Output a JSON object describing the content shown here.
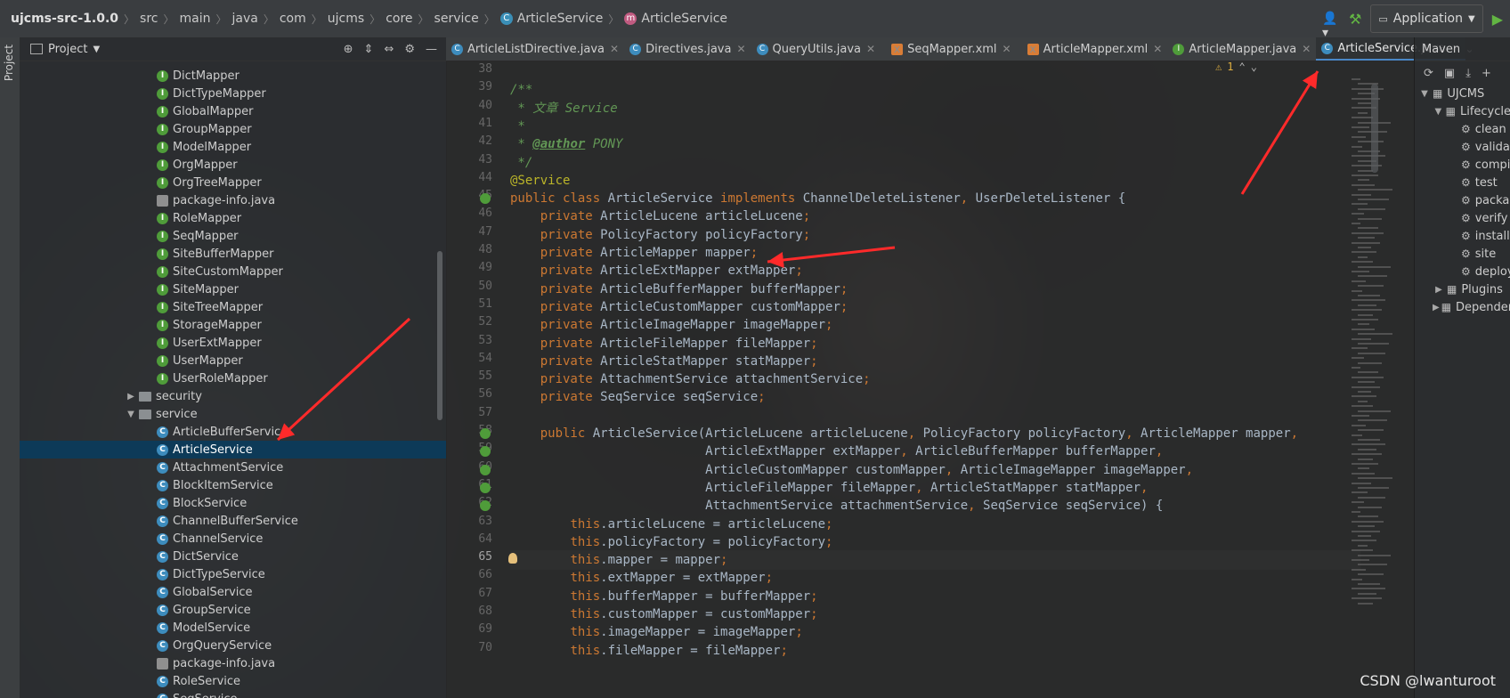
{
  "navbar": {
    "crumbs": [
      "ujcms-src-1.0.0",
      "src",
      "main",
      "java",
      "com",
      "ujcms",
      "core",
      "service",
      "ArticleService",
      "ArticleService"
    ],
    "run_config": "Application"
  },
  "left_stripe": {
    "label": "Project"
  },
  "project": {
    "title": "Project",
    "items": [
      {
        "label": "DictMapper",
        "kind": "i"
      },
      {
        "label": "DictTypeMapper",
        "kind": "i"
      },
      {
        "label": "GlobalMapper",
        "kind": "i"
      },
      {
        "label": "GroupMapper",
        "kind": "i"
      },
      {
        "label": "ModelMapper",
        "kind": "i"
      },
      {
        "label": "OrgMapper",
        "kind": "i"
      },
      {
        "label": "OrgTreeMapper",
        "kind": "i"
      },
      {
        "label": "package-info.java",
        "kind": "f"
      },
      {
        "label": "RoleMapper",
        "kind": "i"
      },
      {
        "label": "SeqMapper",
        "kind": "i"
      },
      {
        "label": "SiteBufferMapper",
        "kind": "i"
      },
      {
        "label": "SiteCustomMapper",
        "kind": "i"
      },
      {
        "label": "SiteMapper",
        "kind": "i"
      },
      {
        "label": "SiteTreeMapper",
        "kind": "i"
      },
      {
        "label": "StorageMapper",
        "kind": "i"
      },
      {
        "label": "UserExtMapper",
        "kind": "i"
      },
      {
        "label": "UserMapper",
        "kind": "i"
      },
      {
        "label": "UserRoleMapper",
        "kind": "i"
      },
      {
        "label": "security",
        "kind": "folder",
        "chev": "collapsed"
      },
      {
        "label": "service",
        "kind": "folder",
        "chev": "expanded"
      },
      {
        "label": "ArticleBufferService",
        "kind": "c"
      },
      {
        "label": "ArticleService",
        "kind": "c",
        "selected": true
      },
      {
        "label": "AttachmentService",
        "kind": "c"
      },
      {
        "label": "BlockItemService",
        "kind": "c"
      },
      {
        "label": "BlockService",
        "kind": "c"
      },
      {
        "label": "ChannelBufferService",
        "kind": "c"
      },
      {
        "label": "ChannelService",
        "kind": "c"
      },
      {
        "label": "DictService",
        "kind": "c"
      },
      {
        "label": "DictTypeService",
        "kind": "c"
      },
      {
        "label": "GlobalService",
        "kind": "c"
      },
      {
        "label": "GroupService",
        "kind": "c"
      },
      {
        "label": "ModelService",
        "kind": "c"
      },
      {
        "label": "OrgQueryService",
        "kind": "c"
      },
      {
        "label": "package-info.java",
        "kind": "f"
      },
      {
        "label": "RoleService",
        "kind": "c"
      },
      {
        "label": "SeqService",
        "kind": "c"
      }
    ]
  },
  "tabs": [
    {
      "label": "ArticleListDirective.java",
      "icon": "c"
    },
    {
      "label": "Directives.java",
      "icon": "c"
    },
    {
      "label": "QueryUtils.java",
      "icon": "c"
    },
    {
      "label": "SeqMapper.xml",
      "icon": "x"
    },
    {
      "label": "ArticleMapper.xml",
      "icon": "x"
    },
    {
      "label": "ArticleMapper.java",
      "icon": "i"
    },
    {
      "label": "ArticleService.java",
      "icon": "c",
      "active": true
    }
  ],
  "editor": {
    "warning_count": "1",
    "line_numbers": [
      "38",
      "39",
      "40",
      "41",
      "42",
      "43",
      "44",
      "45",
      "46",
      "47",
      "48",
      "49",
      "50",
      "51",
      "52",
      "53",
      "54",
      "55",
      "56",
      "57",
      "58",
      "59",
      "60",
      "61",
      "62",
      "63",
      "64",
      "65",
      "66",
      "67",
      "68",
      "69",
      "70"
    ],
    "current_line": "65",
    "code": [
      "",
      "/**",
      " * 文章 Service",
      " *",
      " * @author PONY",
      " */",
      "@Service",
      "public class ArticleService implements ChannelDeleteListener, UserDeleteListener {",
      "    private ArticleLucene articleLucene;",
      "    private PolicyFactory policyFactory;",
      "    private ArticleMapper mapper;",
      "    private ArticleExtMapper extMapper;",
      "    private ArticleBufferMapper bufferMapper;",
      "    private ArticleCustomMapper customMapper;",
      "    private ArticleImageMapper imageMapper;",
      "    private ArticleFileMapper fileMapper;",
      "    private ArticleStatMapper statMapper;",
      "    private AttachmentService attachmentService;",
      "    private SeqService seqService;",
      "",
      "    public ArticleService(ArticleLucene articleLucene, PolicyFactory policyFactory, ArticleMapper mapper,",
      "                          ArticleExtMapper extMapper, ArticleBufferMapper bufferMapper,",
      "                          ArticleCustomMapper customMapper, ArticleImageMapper imageMapper,",
      "                          ArticleFileMapper fileMapper, ArticleStatMapper statMapper,",
      "                          AttachmentService attachmentService, SeqService seqService) {",
      "        this.articleLucene = articleLucene;",
      "        this.policyFactory = policyFactory;",
      "        this.mapper = mapper;",
      "        this.extMapper = extMapper;",
      "        this.bufferMapper = bufferMapper;",
      "        this.customMapper = customMapper;",
      "        this.imageMapper = imageMapper;",
      "        this.fileMapper = fileMapper;"
    ]
  },
  "maven": {
    "title": "Maven",
    "project": "UJCMS",
    "lifecycle": "Lifecycle",
    "goals": [
      "clean",
      "validate",
      "compile",
      "test",
      "package",
      "verify",
      "install",
      "site",
      "deploy"
    ],
    "plugins": "Plugins",
    "dependencies": "Dependencies"
  },
  "watermark": "CSDN @lwanturoot"
}
